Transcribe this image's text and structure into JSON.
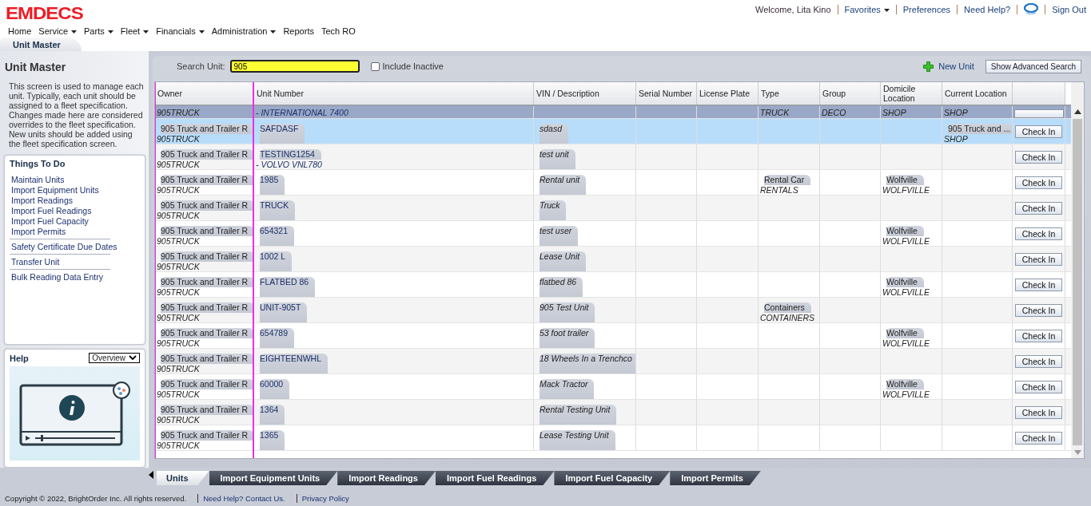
{
  "logo": "EMDECS",
  "user_bar": [
    {
      "kind": "text",
      "label": "Welcome, Lita Kino"
    },
    {
      "kind": "link",
      "label": "Favorites",
      "dropdown": true
    },
    {
      "kind": "link",
      "label": "Preferences",
      "dropdown": false
    },
    {
      "kind": "link",
      "label": "Need Help?",
      "dropdown": false
    },
    {
      "kind": "icon"
    },
    {
      "kind": "link",
      "label": "Sign Out",
      "dropdown": false
    }
  ],
  "menu": [
    {
      "label": "Home",
      "dropdown": false
    },
    {
      "label": "Service",
      "dropdown": true
    },
    {
      "label": "Parts",
      "dropdown": true
    },
    {
      "label": "Fleet",
      "dropdown": true
    },
    {
      "label": "Financials",
      "dropdown": true
    },
    {
      "label": "Administration",
      "dropdown": true
    },
    {
      "label": "Reports",
      "dropdown": false
    },
    {
      "label": "Tech RO",
      "dropdown": false
    }
  ],
  "page_tab": "Unit Master",
  "sidebar": {
    "title": "Unit Master",
    "description": "This screen is used to manage each unit. Typically, each unit should be assigned to a fleet specification. Changes made here are considered overrides to the fleet specification. New units should be added using the fleet specification screen.",
    "things_to_do": {
      "title": "Things To Do",
      "groups": [
        [
          "Maintain Units",
          "Import Equipment Units",
          "Import Readings",
          "Import Fuel Readings",
          "Import Fuel Capacity",
          "Import Permits"
        ],
        [
          "Safety Certificate Due Dates"
        ],
        [
          "Transfer Unit"
        ],
        [
          "Bulk Reading Data Entry"
        ]
      ]
    },
    "help": {
      "title": "Help",
      "topic": "Overview"
    }
  },
  "search": {
    "label": "Search Unit:",
    "value": "905"
  },
  "include_inactive": {
    "label": "Include Inactive",
    "checked": false
  },
  "new_unit": "New Unit",
  "advanced_search": "Show Advanced Search",
  "table": {
    "columns": [
      "Owner",
      "Unit Number",
      "VIN / Description",
      "Serial Number",
      "License Plate",
      "Type",
      "Group",
      "Domicile Location",
      "Current Location"
    ],
    "rows": [
      {
        "owner_code": "905TRUCK",
        "unit_model": "- INTERNATIONAL 7400",
        "type_code": "TRUCK",
        "group_code": "DECO",
        "domicile_code": "SHOP",
        "current_code": "SHOP",
        "selected": true,
        "highlighted": false
      },
      {
        "owner": "905 Truck and Trailer R",
        "owner_code": "905TRUCK",
        "unit": "SAFDASF",
        "vin": "sdasd",
        "current": "905 Truck and ...",
        "current_code": "SHOP",
        "action": "Check In",
        "selected": false,
        "highlighted": true
      },
      {
        "owner": "905 Truck and Trailer R",
        "owner_code": "905TRUCK",
        "unit": "TESTING1254",
        "unit_model": "- VOLVO VNL780",
        "vin": "test unit",
        "action": "Check In",
        "selected": false,
        "highlighted": false
      },
      {
        "owner": "905 Truck and Trailer R",
        "owner_code": "905TRUCK",
        "unit": "1985",
        "vin": "Rental unit",
        "type": "Rental Car",
        "type_code": "RENTALS",
        "domicile": "Wolfville",
        "domicile_code": "WOLFVILLE",
        "action": "Check In",
        "selected": false,
        "highlighted": false
      },
      {
        "owner": "905 Truck and Trailer R",
        "owner_code": "905TRUCK",
        "unit": "TRUCK",
        "vin": "Truck",
        "action": "Check In",
        "selected": false,
        "highlighted": false
      },
      {
        "owner": "905 Truck and Trailer R",
        "owner_code": "905TRUCK",
        "unit": "654321",
        "vin": "test user",
        "domicile": "Wolfville",
        "domicile_code": "WOLFVILLE",
        "action": "Check In",
        "selected": false,
        "highlighted": false
      },
      {
        "owner": "905 Truck and Trailer R",
        "owner_code": "905TRUCK",
        "unit": "1002 L",
        "vin": "Lease Unit",
        "action": "Check In",
        "selected": false,
        "highlighted": false
      },
      {
        "owner": "905 Truck and Trailer R",
        "owner_code": "905TRUCK",
        "unit": "FLATBED 86",
        "vin": "flatbed 86",
        "domicile": "Wolfville",
        "domicile_code": "WOLFVILLE",
        "action": "Check In",
        "selected": false,
        "highlighted": false
      },
      {
        "owner": "905 Truck and Trailer R",
        "owner_code": "905TRUCK",
        "unit": "UNIT-905T",
        "vin": "905 Test Unit",
        "type": "Containers",
        "type_code": "CONTAINERS",
        "action": "Check In",
        "selected": false,
        "highlighted": false
      },
      {
        "owner": "905 Truck and Trailer R",
        "owner_code": "905TRUCK",
        "unit": "654789",
        "vin": "53 foot trailer",
        "domicile": "Wolfville",
        "domicile_code": "WOLFVILLE",
        "action": "Check In",
        "selected": false,
        "highlighted": false
      },
      {
        "owner": "905 Truck and Trailer R",
        "owner_code": "905TRUCK",
        "unit": "EIGHTEENWHL",
        "vin": "18 Wheels In a Trenchco",
        "action": "Check In",
        "selected": false,
        "highlighted": false
      },
      {
        "owner": "905 Truck and Trailer R",
        "owner_code": "905TRUCK",
        "unit": "60000",
        "vin": "Mack Tractor",
        "domicile": "Wolfville",
        "domicile_code": "WOLFVILLE",
        "action": "Check In",
        "selected": false,
        "highlighted": false
      },
      {
        "owner": "905 Truck and Trailer R",
        "owner_code": "905TRUCK",
        "unit": "1364",
        "vin": "Rental Testing Unit",
        "action": "Check In",
        "selected": false,
        "highlighted": false
      },
      {
        "owner": "905 Truck and Trailer R",
        "owner_code": "905TRUCK",
        "unit": "1365",
        "vin": "Lease Testing Unit",
        "action": "Check In",
        "selected": false,
        "highlighted": false
      }
    ]
  },
  "bottom_tabs": [
    {
      "label": "Units",
      "selected": true
    },
    {
      "label": "Import Equipment Units",
      "selected": false
    },
    {
      "label": "Import Readings",
      "selected": false
    },
    {
      "label": "Import Fuel Readings",
      "selected": false
    },
    {
      "label": "Import Fuel Capacity",
      "selected": false
    },
    {
      "label": "Import Permits",
      "selected": false
    }
  ],
  "footer": {
    "copyright": "Copyright © 2022, BrightOrder Inc. All rights reserved.",
    "links": [
      "Need Help? Contact Us.",
      "Privacy Policy"
    ]
  }
}
